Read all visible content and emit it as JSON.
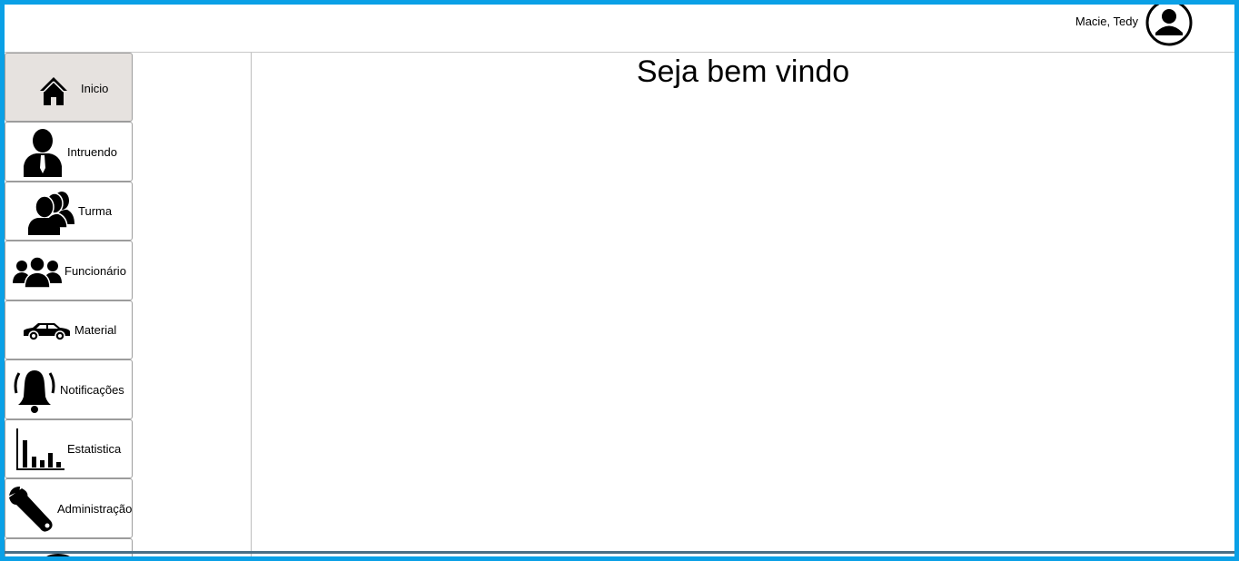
{
  "header": {
    "user_name": "Macie, Tedy",
    "avatar_icon": "user-circle-icon"
  },
  "sidebar": {
    "items": [
      {
        "label": "Inicio",
        "icon": "home-icon",
        "active": true
      },
      {
        "label": "Intruendo",
        "icon": "person-tie-icon"
      },
      {
        "label": "Turma",
        "icon": "group-icon"
      },
      {
        "label": "Funcionário",
        "icon": "people-icon"
      },
      {
        "label": "Material",
        "icon": "car-icon"
      },
      {
        "label": "Notificações",
        "icon": "bell-icon"
      },
      {
        "label": "Estatistica",
        "icon": "bar-chart-icon"
      },
      {
        "label": "Administração",
        "icon": "wrench-icon"
      }
    ]
  },
  "main": {
    "title": "Seja bem vindo"
  },
  "colors": {
    "frame_border": "#0aa0e6",
    "active_item_bg": "#e6e2df"
  }
}
